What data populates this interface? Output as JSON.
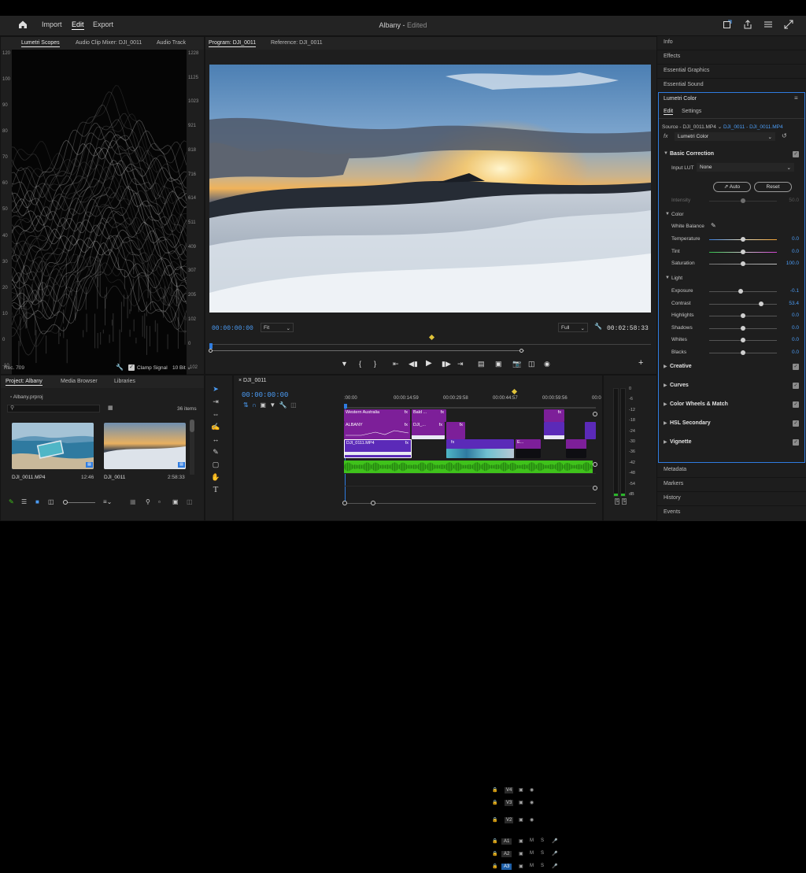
{
  "header": {
    "nav": [
      "Import",
      "Edit",
      "Export"
    ],
    "active_nav": "Edit",
    "project": "Albany",
    "project_status": "Edited",
    "icons": [
      "home-icon",
      "quick-export-icon",
      "share-icon",
      "menu-icon",
      "fullscreen-icon"
    ]
  },
  "scopes": {
    "tabs": [
      "Lumetri Scopes",
      "Audio Clip Mixer: DJI_0011",
      "Audio Track"
    ],
    "left_axis": [
      "120",
      "100",
      "90",
      "80",
      "70",
      "60",
      "50",
      "40",
      "30",
      "20",
      "10",
      "0",
      "-10",
      "-20"
    ],
    "right_axis": [
      "1228",
      "1125",
      "1023",
      "921",
      "818",
      "716",
      "614",
      "511",
      "409",
      "307",
      "205",
      "102",
      "0",
      "-102",
      "-205"
    ],
    "footer_left": "Rec. 709",
    "clamp_label": "Clamp Signal",
    "bit_depth": "10 Bit"
  },
  "program": {
    "tabs": [
      "Program: DJI_0011",
      "Reference: DJI_0011"
    ],
    "timecode": "00:00:00:00",
    "fit": "Fit",
    "quality": "Full",
    "duration": "00:02:58:33"
  },
  "right_panels": {
    "top": [
      "Info",
      "Effects",
      "Essential Graphics",
      "Essential Sound"
    ],
    "bottom": [
      "Metadata",
      "Markers",
      "History",
      "Events"
    ]
  },
  "lumetri": {
    "title": "Lumetri Color",
    "tabs": [
      "Edit",
      "Settings"
    ],
    "source": "Source - DJI_0011.MP4",
    "target": "DJI_0011 - DJI_0011.MP4",
    "fx": "fx",
    "effect": "Lumetri Color",
    "basic_correction": "Basic Correction",
    "input_lut_label": "Input LUT",
    "input_lut_value": "None",
    "auto": "Auto",
    "reset": "Reset",
    "intensity_label": "Intensity",
    "intensity_value": "50.0",
    "color_group": "Color",
    "white_balance": "White Balance",
    "color_sliders": [
      {
        "label": "Temperature",
        "value": "0.0",
        "pos": 0.5
      },
      {
        "label": "Tint",
        "value": "0.0",
        "pos": 0.5
      },
      {
        "label": "Saturation",
        "value": "100.0",
        "pos": 0.5
      }
    ],
    "light_group": "Light",
    "light_sliders": [
      {
        "label": "Exposure",
        "value": "-0.1",
        "pos": 0.47
      },
      {
        "label": "Contrast",
        "value": "53.4",
        "pos": 0.77
      },
      {
        "label": "Highlights",
        "value": "0.0",
        "pos": 0.5
      },
      {
        "label": "Shadows",
        "value": "0.0",
        "pos": 0.5
      },
      {
        "label": "Whites",
        "value": "0.0",
        "pos": 0.5
      },
      {
        "label": "Blacks",
        "value": "0.0",
        "pos": 0.5
      }
    ],
    "sections": [
      "Creative",
      "Curves",
      "Color Wheels & Match",
      "HSL Secondary",
      "Vignette"
    ]
  },
  "project": {
    "tabs": [
      "Project: Albany",
      "Media Browser",
      "Libraries"
    ],
    "file": "Albany.prproj",
    "items_count": "36 items",
    "items": [
      {
        "name": "DJI_0011.MP4",
        "duration": "12:46"
      },
      {
        "name": "DJI_0011",
        "duration": "2:58:33"
      }
    ]
  },
  "timeline": {
    "sequence": "DJI_0011",
    "timecode": "00:00:00:00",
    "ruler": [
      ":00:00",
      "00:00:14:59",
      "00:00:29:58",
      "00:00:44:57",
      "00:00:59:56",
      "00:0"
    ],
    "video_tracks": [
      "V4",
      "V3",
      "V2"
    ],
    "audio_tracks": [
      "A1",
      "A2",
      "A3"
    ],
    "track_mute": "M",
    "track_solo": "S",
    "clips": {
      "v4": [
        {
          "label": "Western Australia",
          "fx": "fx"
        },
        {
          "label": "Bald ...",
          "fx": "fx"
        },
        {
          "label": "",
          "fx": "fx"
        }
      ],
      "v3": [
        {
          "label": "ALBANY",
          "fx": "fx"
        },
        {
          "label": "DJI_...",
          "fx": "fx"
        },
        {
          "label": "",
          "fx": "fx"
        }
      ],
      "v2": [
        {
          "label": "DJI_0111.MP4",
          "fx": "fx"
        },
        {
          "label": "E...",
          "fx": "fx"
        }
      ]
    }
  },
  "meter": {
    "scale": [
      "0",
      "-6",
      "-12",
      "-18",
      "-24",
      "-30",
      "-36",
      "-42",
      "-48",
      "-54",
      "dB"
    ],
    "solo": [
      "S",
      "S"
    ]
  },
  "colors": {
    "accent_blue": "#4b9cf5",
    "clip_purple": "#7d1f99",
    "clip_violet": "#5b2ab8",
    "audio_green": "#3fc21b",
    "playhead": "#2f7ce0"
  }
}
